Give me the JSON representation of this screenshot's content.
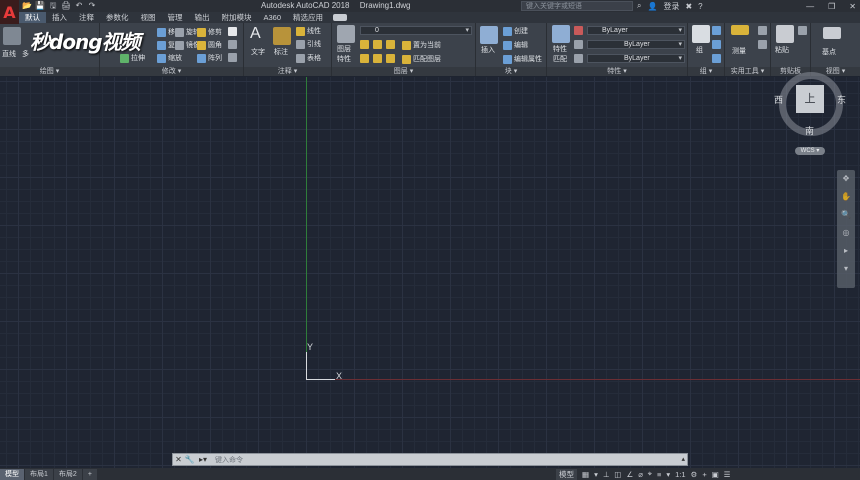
{
  "app": {
    "logo_letter": "A",
    "title": "Autodesk AutoCAD 2018",
    "document": "Drawing1.dwg",
    "search_placeholder": "键入关键字或短语",
    "login_label": "登录"
  },
  "quick_access": [
    "📂",
    "💾",
    "🖫",
    "🖨",
    "↶",
    "↷"
  ],
  "watermark": "秒dong视频",
  "menu_tabs": [
    "默认",
    "插入",
    "注释",
    "参数化",
    "视图",
    "管理",
    "输出",
    "附加模块",
    "A360",
    "精选应用"
  ],
  "ribbon": {
    "draw": {
      "footer": "绘图 ▾",
      "line": "直线",
      "poly": "多"
    },
    "modify": {
      "footer": "修改 ▾",
      "items": [
        "移动",
        "旋转",
        "修剪",
        "复制",
        "镜像",
        "圆角",
        "拉伸",
        "缩放",
        "阵列"
      ]
    },
    "annotation": {
      "footer": "注释 ▾",
      "text": "文字",
      "dimension": "标注",
      "items": [
        "线性",
        "引线",
        "表格"
      ]
    },
    "layers": {
      "footer": "图层 ▾",
      "properties": "图层",
      "properties2": "特性",
      "current_layer": "0",
      "items": [
        "置为当前",
        "匹配图层"
      ]
    },
    "block": {
      "footer": "块 ▾",
      "insert": "插入",
      "items": [
        "创建",
        "编辑",
        "编辑属性"
      ]
    },
    "properties": {
      "footer": "特性 ▾",
      "match": "特性",
      "match2": "匹配",
      "bylayer": [
        "ByLayer",
        "ByLayer",
        "ByLayer"
      ]
    },
    "groups": {
      "footer": "组 ▾",
      "label": "组"
    },
    "utilities": {
      "footer": "实用工具 ▾",
      "measure": "测量"
    },
    "clipboard": {
      "footer": "剪贴板",
      "paste": "粘贴"
    },
    "view": {
      "footer": "视图 ▾",
      "base": "基点"
    }
  },
  "viewcube": {
    "top": "上",
    "west": "西",
    "east": "东",
    "south": "南",
    "wcs": "WCS ▾"
  },
  "ucs": {
    "x": "X",
    "y": "Y"
  },
  "navbar_icons": [
    "✥",
    "✋",
    "🔍",
    "◎",
    "▸",
    "▾"
  ],
  "command_line": {
    "placeholder": "键入命令",
    "close": "✕",
    "wrench": "🔧",
    "recent": "▸▾"
  },
  "layout_tabs": [
    "模型",
    "布局1",
    "布局2",
    "+"
  ],
  "status": {
    "model": "模型",
    "scale": "1:1",
    "icons": [
      "▦",
      "▾",
      "⊥",
      "◫",
      "∠",
      "⌀",
      "⌖",
      "≡",
      "▾",
      "⚙",
      "+",
      "▣",
      "☰"
    ]
  }
}
